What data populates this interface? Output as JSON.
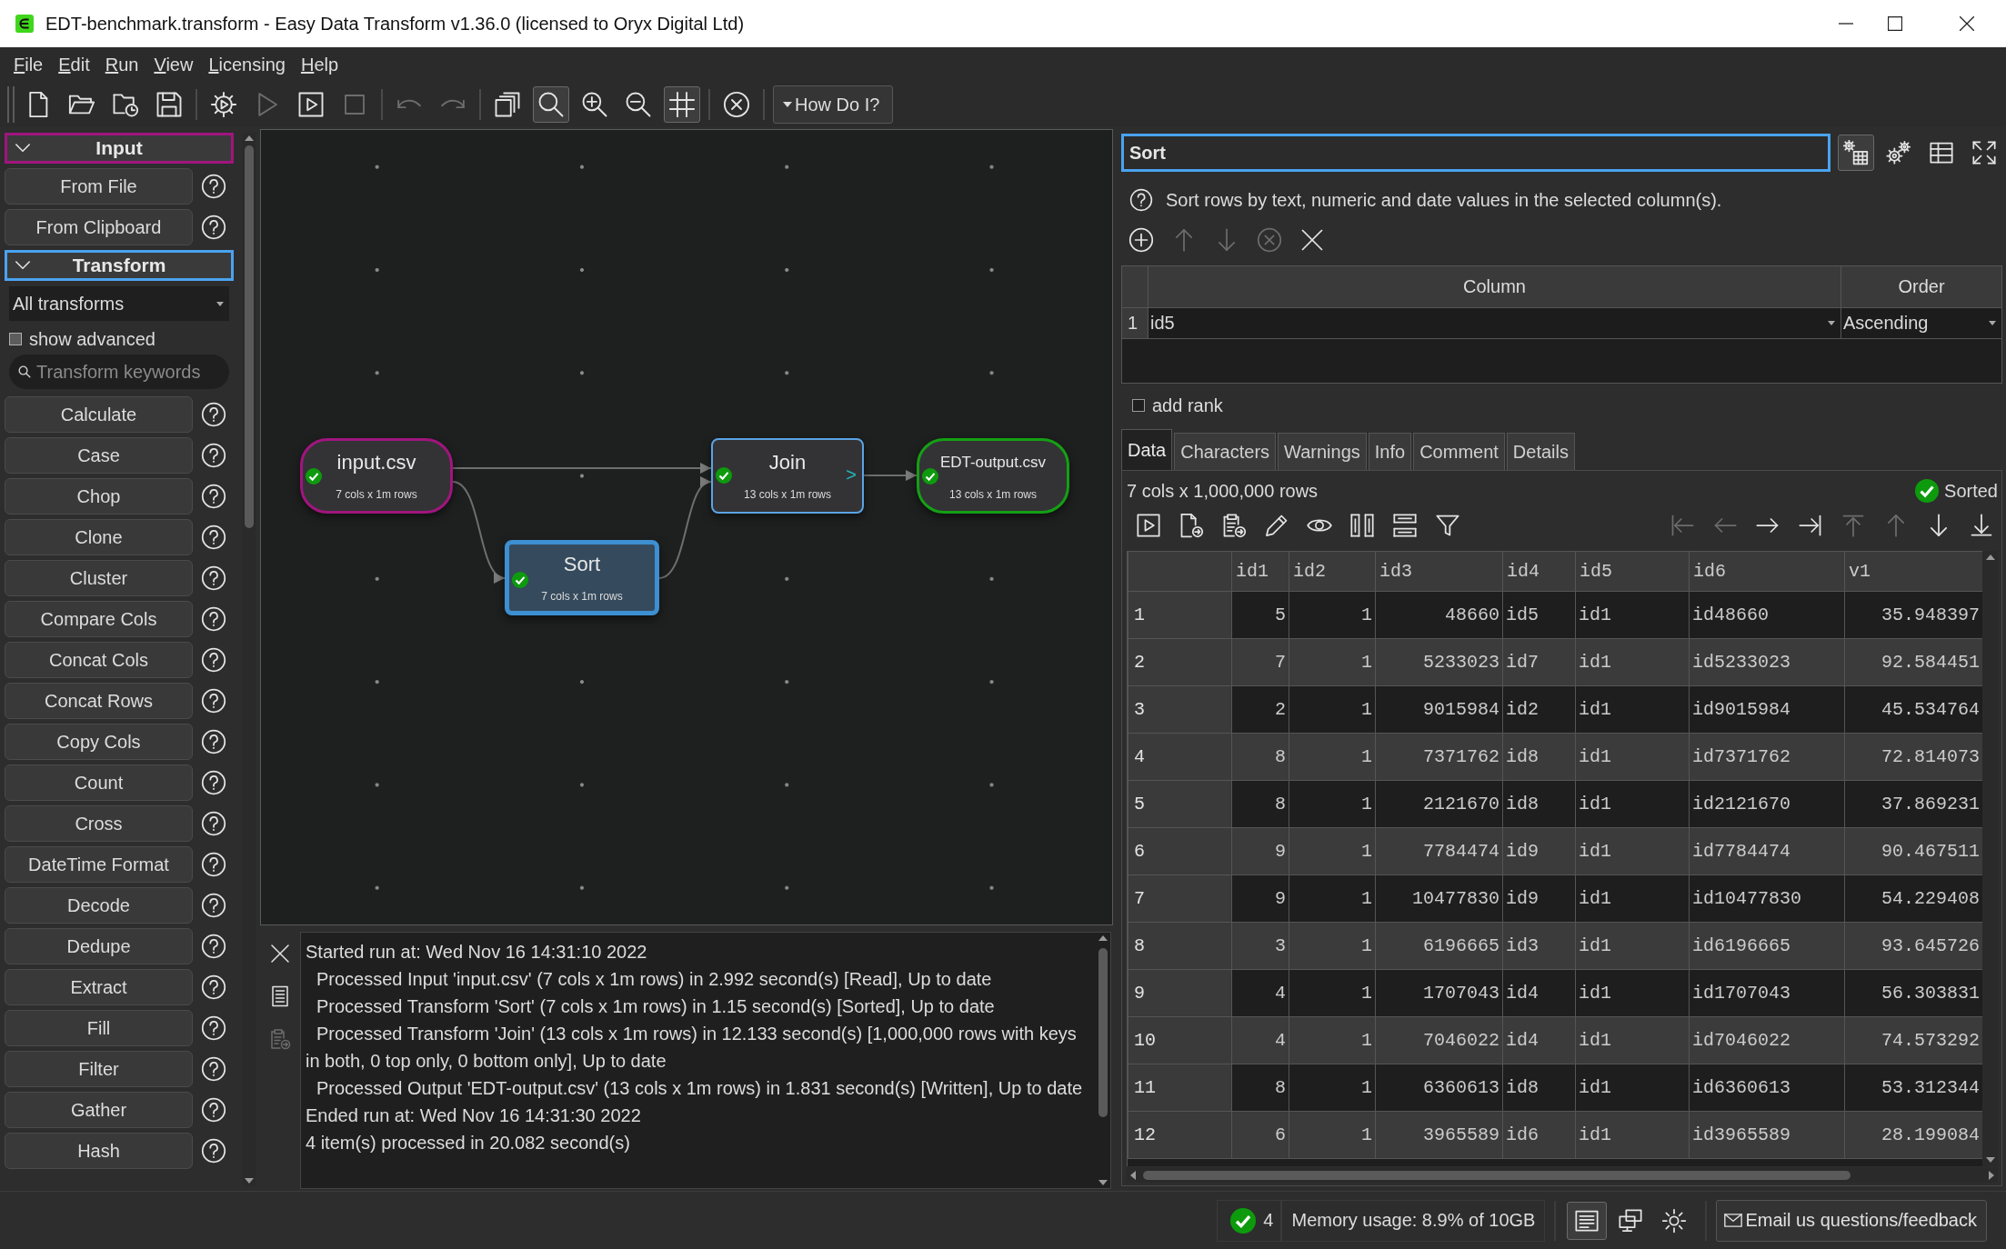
{
  "window": {
    "title": "EDT-benchmark.transform - Easy Data Transform v1.36.0 (licensed to Oryx Digital Ltd)"
  },
  "menu": [
    {
      "label": "File"
    },
    {
      "label": "Edit"
    },
    {
      "label": "Run"
    },
    {
      "label": "View"
    },
    {
      "label": "Licensing"
    },
    {
      "label": "Help"
    }
  ],
  "toolbar": {
    "groups": [
      {
        "buttons": [
          {
            "kind": "new",
            "disabled": false,
            "on": false
          },
          {
            "kind": "open",
            "disabled": false,
            "on": false
          },
          {
            "kind": "recent",
            "disabled": false,
            "on": false
          },
          {
            "kind": "save",
            "disabled": false,
            "on": false
          }
        ]
      },
      {
        "buttons": [
          {
            "kind": "run-settings",
            "disabled": false,
            "on": false
          },
          {
            "kind": "run",
            "disabled": true,
            "on": false
          },
          {
            "kind": "run-step",
            "disabled": false,
            "on": false
          },
          {
            "kind": "stop",
            "disabled": true,
            "on": false
          }
        ]
      },
      {
        "buttons": [
          {
            "kind": "undo",
            "disabled": true,
            "on": false
          },
          {
            "kind": "redo",
            "disabled": true,
            "on": false
          }
        ]
      },
      {
        "buttons": [
          {
            "kind": "duplicate",
            "disabled": false,
            "on": false
          },
          {
            "kind": "search",
            "disabled": false,
            "on": true
          },
          {
            "kind": "zoom-in",
            "disabled": false,
            "on": false
          },
          {
            "kind": "zoom-out",
            "disabled": false,
            "on": false
          },
          {
            "kind": "grid",
            "disabled": false,
            "on": true
          }
        ]
      },
      {
        "buttons": [
          {
            "kind": "cancel",
            "disabled": false,
            "on": false
          }
        ]
      }
    ],
    "help_menu": {
      "label": "How Do I?"
    }
  },
  "sidebar": {
    "sections": [
      {
        "title": "Input",
        "color": "#a0157e",
        "expanded": true,
        "items": [
          {
            "label": "From File"
          },
          {
            "label": "From Clipboard"
          }
        ]
      },
      {
        "title": "Transform",
        "color": "#4aa3ef",
        "expanded": true,
        "filter": {
          "value": "All transforms"
        },
        "show_advanced": {
          "label": "show advanced",
          "checked": false
        },
        "search": {
          "placeholder": "Transform keywords"
        },
        "items": [
          {
            "label": "Calculate"
          },
          {
            "label": "Case"
          },
          {
            "label": "Chop"
          },
          {
            "label": "Clone"
          },
          {
            "label": "Cluster"
          },
          {
            "label": "Compare Cols"
          },
          {
            "label": "Concat Cols"
          },
          {
            "label": "Concat Rows"
          },
          {
            "label": "Copy Cols"
          },
          {
            "label": "Count"
          },
          {
            "label": "Cross"
          },
          {
            "label": "DateTime Format"
          },
          {
            "label": "Decode"
          },
          {
            "label": "Dedupe"
          },
          {
            "label": "Extract"
          },
          {
            "label": "Fill"
          },
          {
            "label": "Filter"
          },
          {
            "label": "Gather"
          },
          {
            "label": "Hash"
          }
        ]
      }
    ]
  },
  "canvas": {
    "nodes": [
      {
        "kind": "input",
        "title": "input.csv",
        "subtitle": "7 cols x 1m rows",
        "ok": true,
        "selected": false
      },
      {
        "kind": "transform",
        "title": "Sort",
        "subtitle": "7 cols x 1m rows",
        "ok": true,
        "selected": true
      },
      {
        "kind": "transform",
        "title": "Join",
        "subtitle": "13 cols x 1m rows",
        "ok": true,
        "selected": false,
        "marker": ">"
      },
      {
        "kind": "output",
        "title": "EDT-output.csv",
        "subtitle": "13 cols x 1m rows",
        "ok": true,
        "selected": false
      }
    ]
  },
  "log": {
    "tools": [
      {
        "kind": "close",
        "disabled": false
      },
      {
        "kind": "document",
        "disabled": false
      },
      {
        "kind": "clipboard-export",
        "disabled": true
      }
    ],
    "lines": [
      {
        "kind": "event",
        "text": "Started run at: Wed Nov 16 14:31:10 2022"
      },
      {
        "kind": "step",
        "text": "Processed Input 'input.csv' (7 cols x 1m rows) in 2.992 second(s) [Read], Up to date"
      },
      {
        "kind": "step",
        "text": "Processed Transform 'Sort' (7 cols x 1m rows) in 1.15 second(s) [Sorted], Up to date"
      },
      {
        "kind": "step",
        "text": "Processed Transform 'Join' (13 cols x 1m rows) in 12.133 second(s) [1,000,000 rows with keys in both, 0 top only, 0 bottom only], Up to date"
      },
      {
        "kind": "step",
        "text": "Processed Output 'EDT-output.csv' (13 cols x 1m rows) in 1.831 second(s) [Written], Up to date"
      },
      {
        "kind": "event",
        "text": "Ended run at: Wed Nov 16 14:31:30 2022"
      },
      {
        "kind": "event",
        "text": "4 item(s) processed in 20.082 second(s)"
      }
    ]
  },
  "properties": {
    "name": "Sort",
    "view_buttons": [
      {
        "kind": "gears-table",
        "on": true
      },
      {
        "kind": "gears",
        "on": false
      },
      {
        "kind": "table",
        "on": false
      },
      {
        "kind": "expand",
        "on": false
      }
    ],
    "description": "Sort rows by text, numeric and date values in the selected column(s).",
    "edit_buttons": [
      {
        "kind": "add",
        "disabled": false
      },
      {
        "kind": "up",
        "disabled": true
      },
      {
        "kind": "down",
        "disabled": true
      },
      {
        "kind": "clear",
        "disabled": true
      },
      {
        "kind": "delete",
        "disabled": false
      }
    ],
    "sort_table": {
      "columns": [
        "Column",
        "Order"
      ],
      "rows": [
        {
          "number": "1",
          "column": "id5",
          "order": "Ascending"
        }
      ]
    },
    "add_rank": {
      "label": "add rank",
      "checked": false
    }
  },
  "tabs": [
    {
      "label": "Data",
      "selected": true
    },
    {
      "label": "Characters",
      "selected": false
    },
    {
      "label": "Warnings",
      "selected": false
    },
    {
      "label": "Info",
      "selected": false
    },
    {
      "label": "Comment",
      "selected": false
    },
    {
      "label": "Details",
      "selected": false
    }
  ],
  "data": {
    "summary": "7 cols x 1,000,000 rows",
    "result": {
      "kind": "ok",
      "label": "Sorted"
    },
    "tools": [
      {
        "kind": "run-step"
      },
      {
        "kind": "file-export"
      },
      {
        "kind": "clipboard-export"
      },
      {
        "kind": "edit"
      },
      {
        "kind": "view"
      },
      {
        "kind": "columns"
      },
      {
        "kind": "rows"
      },
      {
        "kind": "filter"
      }
    ],
    "navigation": [
      {
        "kind": "first",
        "disabled": true
      },
      {
        "kind": "left",
        "disabled": true
      },
      {
        "kind": "right",
        "disabled": false
      },
      {
        "kind": "last",
        "disabled": false
      },
      {
        "kind": "top",
        "disabled": true
      },
      {
        "kind": "up",
        "disabled": true
      },
      {
        "kind": "down",
        "disabled": false
      },
      {
        "kind": "bottom",
        "disabled": false
      }
    ],
    "columns": [
      {
        "label": "id1",
        "kind": "number"
      },
      {
        "label": "id2",
        "kind": "number"
      },
      {
        "label": "id3",
        "kind": "number"
      },
      {
        "label": "id4",
        "kind": "text"
      },
      {
        "label": "id5",
        "kind": "text"
      },
      {
        "label": "id6",
        "kind": "text"
      },
      {
        "label": "v1",
        "kind": "number"
      }
    ],
    "rows": [
      {
        "number": "1",
        "cells": [
          "5",
          "1",
          "48660",
          "id5",
          "id1",
          "id48660",
          "35.948397"
        ]
      },
      {
        "number": "2",
        "cells": [
          "7",
          "1",
          "5233023",
          "id7",
          "id1",
          "id5233023",
          "92.584451"
        ]
      },
      {
        "number": "3",
        "cells": [
          "2",
          "1",
          "9015984",
          "id2",
          "id1",
          "id9015984",
          "45.534764"
        ]
      },
      {
        "number": "4",
        "cells": [
          "8",
          "1",
          "7371762",
          "id8",
          "id1",
          "id7371762",
          "72.814073"
        ]
      },
      {
        "number": "5",
        "cells": [
          "8",
          "1",
          "2121670",
          "id8",
          "id1",
          "id2121670",
          "37.869231"
        ]
      },
      {
        "number": "6",
        "cells": [
          "9",
          "1",
          "7784474",
          "id9",
          "id1",
          "id7784474",
          "90.467511"
        ]
      },
      {
        "number": "7",
        "cells": [
          "9",
          "1",
          "10477830",
          "id9",
          "id1",
          "id10477830",
          "54.229408"
        ]
      },
      {
        "number": "8",
        "cells": [
          "3",
          "1",
          "6196665",
          "id3",
          "id1",
          "id6196665",
          "93.645726"
        ]
      },
      {
        "number": "9",
        "cells": [
          "4",
          "1",
          "1707043",
          "id4",
          "id1",
          "id1707043",
          "56.303831"
        ]
      },
      {
        "number": "10",
        "cells": [
          "4",
          "1",
          "7046022",
          "id4",
          "id1",
          "id7046022",
          "74.573292"
        ]
      },
      {
        "number": "11",
        "cells": [
          "8",
          "1",
          "6360613",
          "id8",
          "id1",
          "id6360613",
          "53.312344"
        ]
      },
      {
        "number": "12",
        "cells": [
          "6",
          "1",
          "3965589",
          "id6",
          "id1",
          "id3965589",
          "28.199084"
        ]
      }
    ]
  },
  "status_bar": {
    "count": "4",
    "memory": "Memory usage: 8.9% of 10GB",
    "buttons": [
      {
        "kind": "log",
        "on": true
      },
      {
        "kind": "windows",
        "on": false
      },
      {
        "kind": "theme",
        "on": false
      }
    ],
    "feedback": {
      "label": "Email us questions/feedback"
    }
  }
}
